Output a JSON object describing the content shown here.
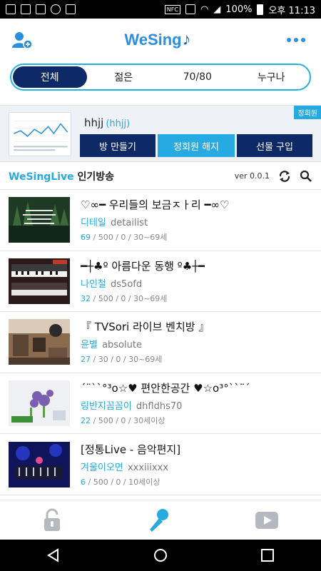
{
  "status_bar": {
    "nfc": "NFC",
    "battery_text": "100%",
    "time": "오후 11:13"
  },
  "header": {
    "logo_text": "WeSing",
    "add_friend_icon": "add-user-icon",
    "more_icon": "more-dots-icon"
  },
  "tabs": [
    {
      "label": "전체",
      "active": true
    },
    {
      "label": "젊은",
      "active": false
    },
    {
      "label": "70/80",
      "active": false
    },
    {
      "label": "누구나",
      "active": false
    }
  ],
  "user_panel": {
    "name": "hhjj",
    "id": "(hhjj)",
    "badge": "정회원",
    "buttons": [
      "방 만들기",
      "정회원 해지",
      "선물 구입"
    ]
  },
  "live_bar": {
    "brand": "WeSingLive",
    "title": "인기방송",
    "version": "ver 0.0.1"
  },
  "rooms": [
    {
      "title": "♡∞━ 우리들의 보금ㅈㅏ리 ━∞♡",
      "host": "디테일",
      "id": "detailist",
      "count": "69",
      "stats": " / 500 / 0 / 30~69세"
    },
    {
      "title": "━┼♣º 아름다운 동행 º♣┼━",
      "host": "나인철",
      "id": "ds5ofd",
      "count": "32",
      "stats": " / 500 / 0 / 30~69세"
    },
    {
      "title": "『 TVSori  라이브 벤치방 』",
      "host": "윤별",
      "id": "absolute",
      "count": "27",
      "stats": " / 30 / 0 / 30~69세"
    },
    {
      "title": "´¨``°³o☆♥ 편안한공간 ♥☆o³°``¨´",
      "host": "링반지꼼꼼이",
      "id": "dhfldhs70",
      "count": "22",
      "stats": " / 500 / 0 / 30세이상"
    },
    {
      "title": "  [정통Live - 음악편지]",
      "host": "겨울이오면",
      "id": "xxxiiixxx",
      "count": "6",
      "stats": " / 500 / 0 / 10세이상"
    }
  ],
  "colors": {
    "accent": "#27a9e1",
    "navy": "#0d2a66",
    "panel_bg": "#eef2f6"
  }
}
